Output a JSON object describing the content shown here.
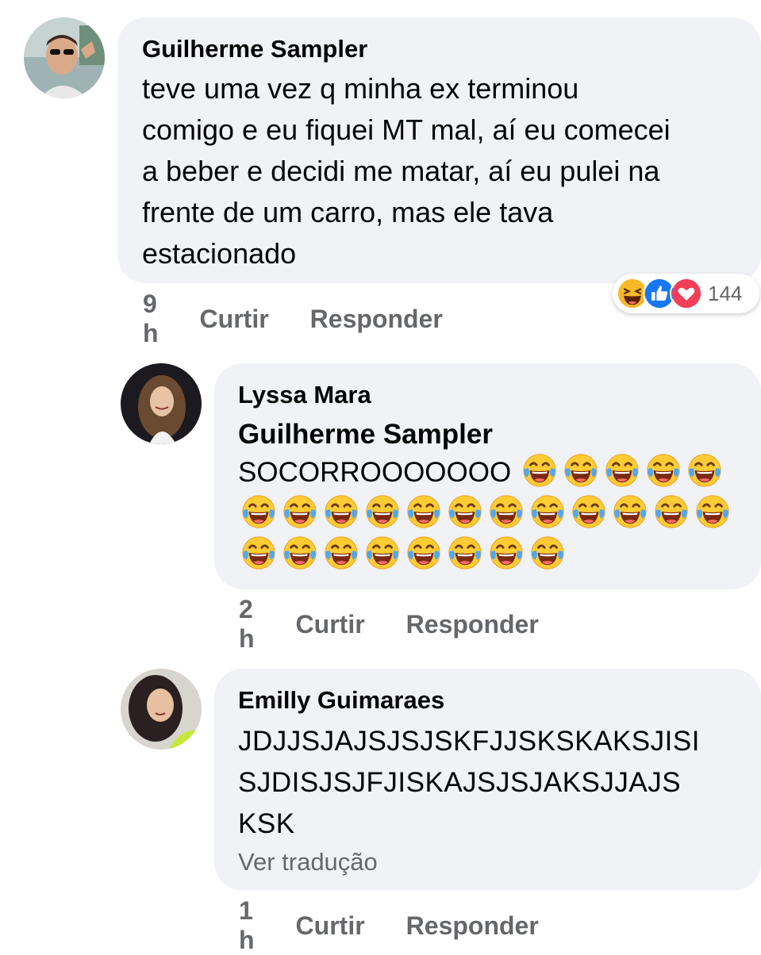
{
  "comments": [
    {
      "author": "Guilherme Sampler",
      "text_lines": [
        "teve uma vez q minha ex terminou",
        "comigo e eu fiquei MT mal, aí eu comecei",
        "a beber e decidi me matar, aí eu pulei na",
        "frente de um carro, mas ele tava",
        "estacionado"
      ],
      "time": "9 h",
      "like_label": "Curtir",
      "reply_label": "Responder",
      "reactions": {
        "icons": [
          "laugh-reaction-icon",
          "like-reaction-icon",
          "love-reaction-icon"
        ],
        "count": "144"
      }
    },
    {
      "author": "Lyssa Mara",
      "mention": "Guilherme Sampler",
      "text": "SOCORROOOOOOO",
      "emoji_count": 25,
      "time": "2 h",
      "like_label": "Curtir",
      "reply_label": "Responder"
    },
    {
      "author": "Emilly Guimaraes",
      "text_lines": [
        "JDJJSJAJSJSJSKFJJSKSKAKSJISI",
        "SJDISJSJFJISKAJSJSJAKSJJAJS",
        "KSK"
      ],
      "translate_label": "Ver tradução",
      "time": "1 h",
      "like_label": "Curtir",
      "reply_label": "Responder"
    }
  ],
  "colors": {
    "bubble": "#f0f2f5",
    "meta": "#65676b",
    "like_blue": "#1877f2",
    "love_red": "#f33e58",
    "haha_yellow": "#f7b928"
  }
}
